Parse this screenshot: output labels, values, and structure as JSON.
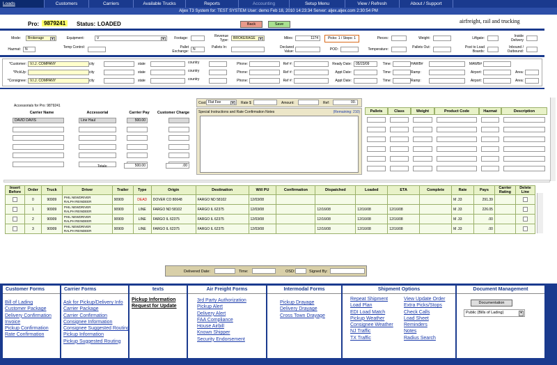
{
  "nav": [
    {
      "label": "Loads",
      "w": 64,
      "active": true
    },
    {
      "label": "Customers",
      "w": 64
    },
    {
      "label": "Carriers",
      "w": 64
    },
    {
      "label": "Available Trucks",
      "w": 75
    },
    {
      "label": "Reports",
      "w": 76
    },
    {
      "label": "Accounting",
      "w": 73,
      "dim": true
    },
    {
      "label": "Setup Menu",
      "w": 80
    },
    {
      "label": "View / Refresh",
      "w": 78
    },
    {
      "label": "About / Support",
      "w": 77
    }
  ],
  "status_bar": "Aljex T3 System for: TEST SYSTEM    User: demo   Feb 18, 2010 14:23:34    Server: aljex.aljex.com    2:30:54 PM",
  "header": {
    "pro_label": "Pro:",
    "pro_value": "9879241",
    "status_label": "Status:",
    "status_value": "LOADED",
    "back_label": "Back",
    "save_label": "Save",
    "tagline": "airfreight, rail and trucking"
  },
  "row1": {
    "mode_label": "Mode:",
    "mode_value": "Brokerage",
    "equipment_label": "Equipment:",
    "equipment_value": "V",
    "footage_label": "Footage:",
    "revenue_type_label": "Revenue Type:",
    "revenue_type_value": "BROKERAGE",
    "miles_label": "Miles:",
    "miles_value": "1174",
    "picks_label": "Picks: 1 / Stops: 1",
    "pieces_label": "Pieces:",
    "weight_label": "Weight:",
    "liftgate_label": "Liftgate:",
    "inside_delivery_label": "Inside Delivery"
  },
  "row2": {
    "hazmat_label": "Hazmat:",
    "hazmat_value": "N",
    "temp_control_label": "Temp Control:",
    "pallet_exchange_label": "Pallet Exchange:",
    "pallet_exchange_value": "N",
    "pallets_in_label": "Pallets In:",
    "declared_value_label": "Declared Value:",
    "pod_label": "POD:",
    "temperature_label": "Temperature:",
    "pallets_out_label": "Pallets Out:",
    "post_to_load_boards_label": "Post to Load Boards:",
    "inbound_outbound_label": "Inbound / Outbound:"
  },
  "parties": {
    "customer_label": "*Customer:",
    "customer_value": "V.I.J. COMPANY",
    "pickup_label": "*PickUp:",
    "consignee_label": "*Consignee:",
    "consignee_value": "V.I.J. COMPANY",
    "city_label": "city",
    "state_label": "state",
    "country_label": "country",
    "phone_label": "Phone:",
    "ref_label": "Ref #:",
    "ready_date_label": "Ready Date:",
    "ready_date_value": "05/23/09",
    "appt_date_label": "Appt Date:",
    "time_label": "Time:",
    "hawb_label": "HAWB#",
    "mawb_label": "MAWB#",
    "ramp_label": "Ramp:",
    "airport_label": "Airport:",
    "area_label": "Area:"
  },
  "accessorials": {
    "title": "Accessorials for Pro: 9879241",
    "col_carrier_name": "Carrier Name",
    "col_accessorial": "Accessorial",
    "col_carrier_pay": "Carrier Pay",
    "col_customer_charge": "Customer Charge",
    "row_carrier": "DAVID DAVIS",
    "row_accessorial": "Line Haul",
    "row_carrier_pay": "500.00",
    "totals_label": "Totals:",
    "total_pay": "500.00",
    "total_charge": ".00"
  },
  "cost": {
    "cost_label": "Cost:",
    "cost_value": "Flat Fee",
    "rate_label": "Rate $",
    "amount_label": "Amount:",
    "ref_label": "Ref:",
    "ref_value": "00.",
    "instructions_label": "Special Instructions and Rate Confirmation Notes",
    "remaining": "(Remaining: 210)"
  },
  "commodity_cols": [
    "Pallets",
    "Class",
    "Weight",
    "Product Code",
    "Hazmat",
    "Description"
  ],
  "trips": {
    "headers": [
      "Insert Before",
      "Order",
      "Truck",
      "Driver",
      "Trailer",
      "Type",
      "Origin",
      "Destination",
      "Will PU",
      "Confirmation",
      "Dispatched",
      "Loaded",
      "ETA",
      "Complete",
      "Rate",
      "Pays",
      "Carrier Rating",
      "Delete Line"
    ],
    "rows": [
      {
        "order": "0",
        "truck": "90909",
        "driver1": "PHIL NEWDRIVER",
        "driver2": "RALPH REINDEER",
        "trailer": "90909",
        "type": "DEAD",
        "origin": "DOVER CO 80648",
        "destination": "FARGO ND 58102",
        "will_pu": "12/03/08",
        "confirmation": "",
        "dispatched": "",
        "loaded": "",
        "eta": "",
        "complete": "",
        "rate": "M .33",
        "pays": "291.39"
      },
      {
        "order": "1",
        "truck": "90909",
        "driver1": "PHIL NEWDRIVER",
        "driver2": "RALPH REINDEER",
        "trailer": "90909",
        "type": "LINE",
        "origin": "FARGO ND 58102",
        "destination": "FARGO IL 62375",
        "will_pu": "12/03/08",
        "confirmation": "",
        "dispatched": "12/16/08",
        "loaded": "12/16/08",
        "eta": "12/16/08",
        "complete": "",
        "rate": "M .33",
        "pays": "226.05"
      },
      {
        "order": "2",
        "truck": "90909",
        "driver1": "PHIL NEWDRIVER",
        "driver2": "RALPH REINDEER",
        "trailer": "90909",
        "type": "LINE",
        "origin": "FARGO IL 62375",
        "destination": "FARGO IL 62375",
        "will_pu": "12/03/08",
        "confirmation": "",
        "dispatched": "12/16/08",
        "loaded": "12/16/08",
        "eta": "12/16/08",
        "complete": "",
        "rate": "M .33",
        "pays": ".00"
      },
      {
        "order": "3",
        "truck": "90909",
        "driver1": "PHIL NEWDRIVER",
        "driver2": "RALPH REINDEER",
        "trailer": "90909",
        "type": "LINE",
        "origin": "FARGO IL 62375",
        "destination": "FARGO IL 62375",
        "will_pu": "12/03/08",
        "confirmation": "",
        "dispatched": "12/16/08",
        "loaded": "12/16/08",
        "eta": "12/16/08",
        "complete": "",
        "rate": "M .33",
        "pays": ".00"
      }
    ]
  },
  "delivery_bar": {
    "delivered_date_label": "Delivered Date:",
    "time_label": "Time:",
    "osd_label": "OSD:",
    "signed_by_label": "Signed By:"
  },
  "forms": {
    "customer_forms": {
      "title": "Customer Forms",
      "links": [
        "Bill of Lading",
        "Customer Package",
        "Delivery Confirmation",
        "Invoice",
        "Pickup Confirmation",
        "Rate Confirmation"
      ]
    },
    "carrier_forms": {
      "title": "Carrier Forms",
      "links": [
        "Ask for Pickup/Delivery Info",
        "Carrier Package",
        "Carrier Confirmation",
        "Consignee Information",
        "Consignee Suggested Routing",
        "Pickup Information",
        "Pickup Suggested Routing"
      ]
    },
    "texts": {
      "title": "texts",
      "links": [
        "Pickup Information",
        "Request for Update"
      ]
    },
    "air_freight_forms": {
      "title": "Air Freight Forms",
      "links": [
        "3rd Party Authorization",
        "Pickup Alert",
        "Delivery Alert",
        "FAA Compliance",
        "House Airbill",
        "Known Shipper",
        "Security Endorsement"
      ]
    },
    "intermodal_forms": {
      "title": "Intermodal Forms",
      "links": [
        "Pickup Drayage",
        "Delivery Drayage",
        "Cross Town Drayage"
      ]
    },
    "shipment_options": {
      "title": "Shipment Options",
      "links_left": [
        "Repeat Shipment",
        "Load Plan",
        "EDI Load Match",
        "Pickup Weather",
        "Consignee Weather",
        "NJ Traffic",
        "TX Traffic"
      ],
      "links_right": [
        "View Update Order",
        "Extra Picks/Stops",
        "Check Calls",
        "Load Sheet",
        "Reminders",
        "Notes",
        "Radius Search"
      ]
    },
    "document_management": {
      "title": "Document Management",
      "button_label": "Documentation",
      "select_value": "Public (Bills of Lading)"
    }
  }
}
